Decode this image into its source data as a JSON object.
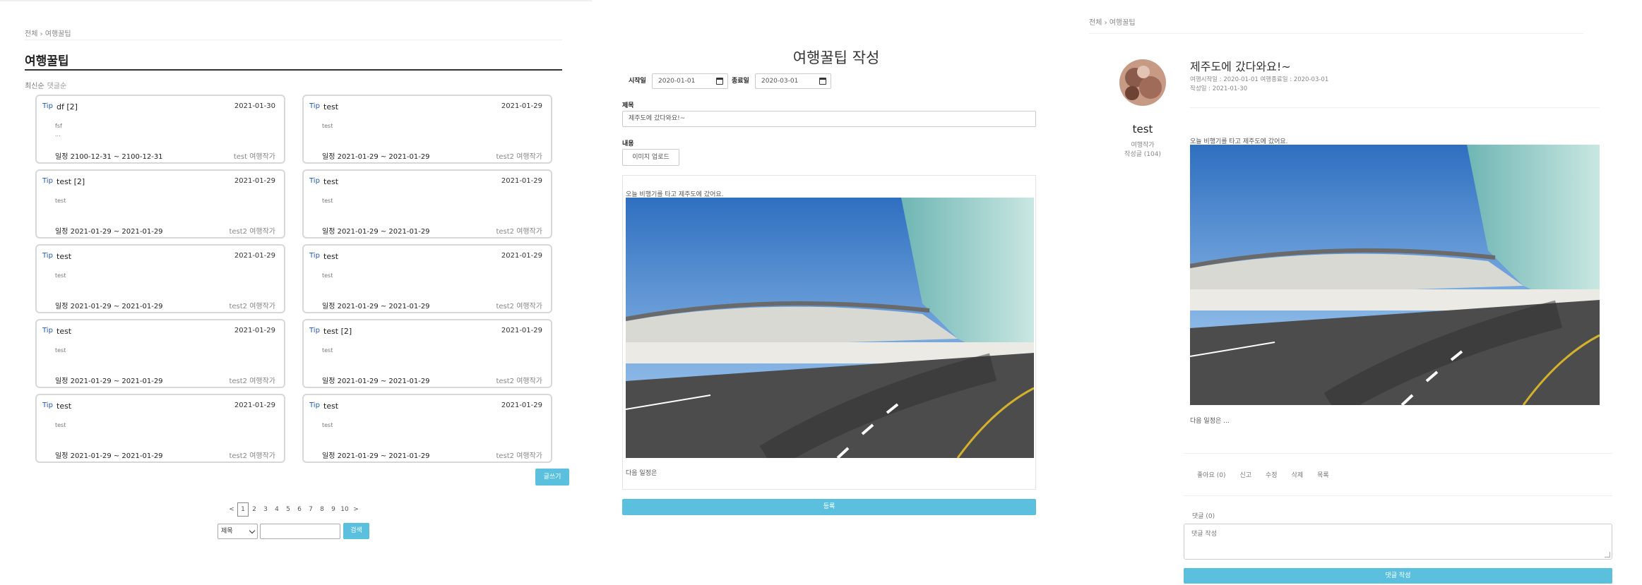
{
  "list": {
    "breadcrumb": "전체 › 여행꿀팁",
    "title": "여행꿀팁",
    "sort": {
      "latest": "최신순",
      "comments": "댓글순"
    },
    "cards": [
      {
        "tip": "Tip",
        "title": "df [2]",
        "date": "2021-01-30",
        "body": "fsf",
        "body2": "...",
        "schedule": "일정 2100-12-31 ~ 2100-12-31",
        "author": "test 여행작가"
      },
      {
        "tip": "Tip",
        "title": "test",
        "date": "2021-01-29",
        "body": "test",
        "body2": "",
        "schedule": "일정 2021-01-29 ~ 2021-01-29",
        "author": "test2 여행작가"
      },
      {
        "tip": "Tip",
        "title": "test [2]",
        "date": "2021-01-29",
        "body": "test",
        "body2": "",
        "schedule": "일정 2021-01-29 ~ 2021-01-29",
        "author": "test2 여행작가"
      },
      {
        "tip": "Tip",
        "title": "test",
        "date": "2021-01-29",
        "body": "test",
        "body2": "",
        "schedule": "일정 2021-01-29 ~ 2021-01-29",
        "author": "test2 여행작가"
      },
      {
        "tip": "Tip",
        "title": "test",
        "date": "2021-01-29",
        "body": "test",
        "body2": "",
        "schedule": "일정 2021-01-29 ~ 2021-01-29",
        "author": "test2 여행작가"
      },
      {
        "tip": "Tip",
        "title": "test",
        "date": "2021-01-29",
        "body": "test",
        "body2": "",
        "schedule": "일정 2021-01-29 ~ 2021-01-29",
        "author": "test2 여행작가"
      },
      {
        "tip": "Tip",
        "title": "test",
        "date": "2021-01-29",
        "body": "test",
        "body2": "",
        "schedule": "일정 2021-01-29 ~ 2021-01-29",
        "author": "test2 여행작가"
      },
      {
        "tip": "Tip",
        "title": "test [2]",
        "date": "2021-01-29",
        "body": "test",
        "body2": "",
        "schedule": "일정 2021-01-29 ~ 2021-01-29",
        "author": "test2 여행작가"
      },
      {
        "tip": "Tip",
        "title": "test",
        "date": "2021-01-29",
        "body": "test",
        "body2": "",
        "schedule": "일정 2021-01-29 ~ 2021-01-29",
        "author": "test2 여행작가"
      },
      {
        "tip": "Tip",
        "title": "test",
        "date": "2021-01-29",
        "body": "test",
        "body2": "",
        "schedule": "일정 2021-01-29 ~ 2021-01-29",
        "author": "test2 여행작가"
      }
    ],
    "write_label": "글쓰기",
    "pager": {
      "prev": "<",
      "pages": [
        "1",
        "2",
        "3",
        "4",
        "5",
        "6",
        "7",
        "8",
        "9",
        "10"
      ],
      "current": "1",
      "next": ">"
    },
    "search": {
      "field": "제목",
      "button": "검색"
    }
  },
  "write": {
    "title": "여행꿀팁 작성",
    "start_label": "시작일",
    "start_value": "2020-01-01",
    "end_label": "종료일",
    "end_value": "2020-03-01",
    "subject_label": "제목",
    "subject_value": "제주도에 갔다와요!~",
    "content_label": "내용",
    "upload_label": "이미지 업로드",
    "content_line1": "오늘 비행기를 타고 제주도에 갔어요.",
    "content_line2": "다음 일정은",
    "submit_label": "등록"
  },
  "detail": {
    "breadcrumb": "전체 › 여행꿀팁",
    "author_name": "test",
    "author_role": "여행작가",
    "author_posts": "작성글 (104)",
    "title": "제주도에 갔다와요!~",
    "meta_dates": "여행시작일 : 2020-01-01 여행종료일 : 2020-03-01",
    "meta_written": "작성일 : 2021-01-30",
    "content_line1": "오늘 비행기를 타고 제주도에 갔어요.",
    "content_line2": "다음 일정은 ...",
    "actions": {
      "like": "좋아요 (0)",
      "report": "신고",
      "edit": "수정",
      "delete": "삭제",
      "list": "목록"
    },
    "comment_count": "댓글 (0)",
    "comment_placeholder": "댓글 작성",
    "comment_submit": "댓글 작성"
  },
  "colors": {
    "accent": "#5bc0de",
    "tip": "#1f5ab5"
  }
}
